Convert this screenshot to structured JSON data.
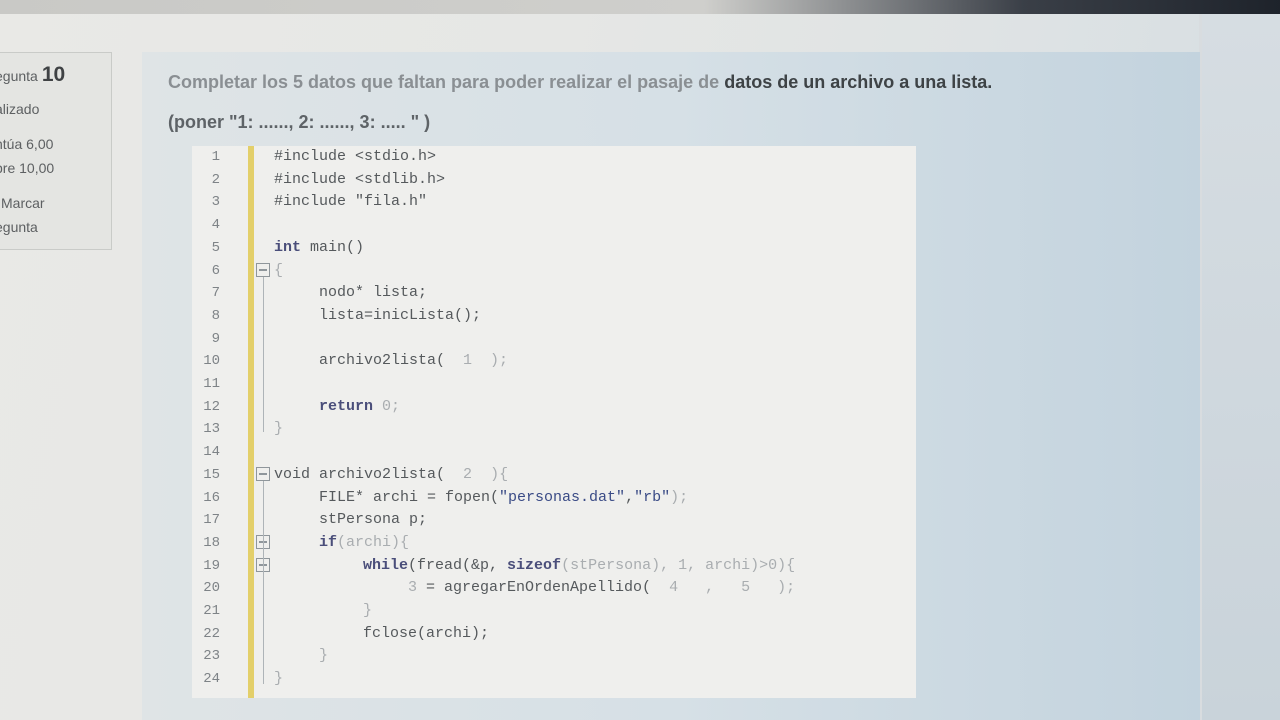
{
  "sidebar": {
    "question_label": "egunta",
    "question_number": "10",
    "status": "alizado",
    "score": "ntúa 6,00",
    "max": "bre 10,00",
    "flag_label": "Marcar",
    "flag_label2": "egunta"
  },
  "question": {
    "text_light": "Completar los 5 datos que faltan para poder realizar el pasaje de",
    "text_strong": "datos de un archivo a una lista.",
    "instruction": "(poner \"1: ......, 2: ......, 3: ..... \" )"
  },
  "code": {
    "line_numbers": [
      "1",
      "2",
      "3",
      "4",
      "5",
      "6",
      "7",
      "8",
      "9",
      "10",
      "11",
      "12",
      "13",
      "14",
      "15",
      "16",
      "17",
      "18",
      "19",
      "20",
      "21",
      "22",
      "23",
      "24"
    ],
    "l1": "#include <stdio.h>",
    "l2": "#include <stdlib.h>",
    "l3": "#include \"fila.h\"",
    "l5_kw": "int",
    "l5_rest": " main()",
    "l6": "{",
    "l7": "nodo* lista;",
    "l8": "lista=inicLista();",
    "l10_a": "archivo2lista(",
    "l10_blank": "  1  ",
    "l10_b": ");",
    "l12_kw": "return",
    "l12_rest": " 0;",
    "l13": "}",
    "l15_kw": "void",
    "l15_a": " archivo2lista(",
    "l15_blank": "  2  ",
    "l15_b": "){",
    "l16_a": "FILE* archi = fopen(",
    "l16_s1": "\"personas.dat\"",
    "l16_c": ",",
    "l16_s2": "\"rb\"",
    "l16_b": ");",
    "l17": "stPersona p;",
    "l18_kw": "if",
    "l18_rest": "(archi){",
    "l19_kw": "while",
    "l19_a": "(fread(&p, ",
    "l19_kw2": "sizeof",
    "l19_b": "(stPersona), 1, archi)>0){",
    "l20_blank3": "3",
    "l20_a": " = agregarEnOrdenApellido(",
    "l20_blank4": "  4   ",
    "l20_comma": ",",
    "l20_blank5": "   5   ",
    "l20_b": ");",
    "l21": "}",
    "l22": "fclose(archi);",
    "l23": "}",
    "l24": "}"
  }
}
